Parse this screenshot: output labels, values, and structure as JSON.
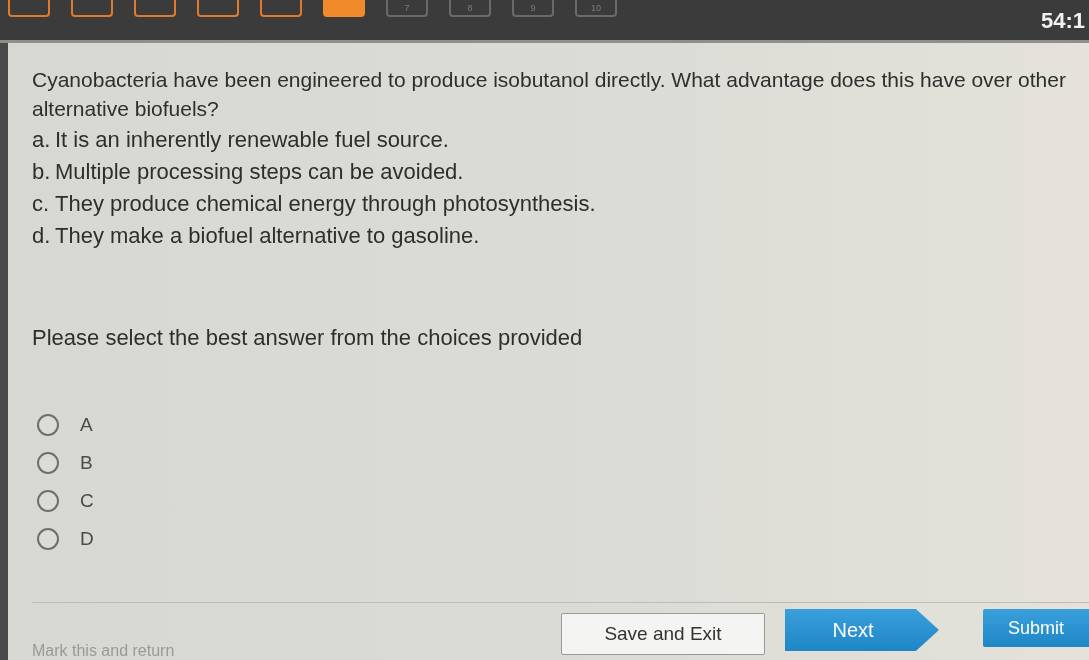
{
  "nav": {
    "questions": [
      {
        "answered": true,
        "selected": false
      },
      {
        "answered": true,
        "selected": false
      },
      {
        "answered": true,
        "selected": false
      },
      {
        "answered": true,
        "selected": false
      },
      {
        "answered": true,
        "selected": false
      },
      {
        "answered": false,
        "selected": true
      },
      {
        "label": "7",
        "answered": false,
        "selected": false
      },
      {
        "label": "8",
        "answered": false,
        "selected": false
      },
      {
        "label": "9",
        "answered": false,
        "selected": false
      },
      {
        "label": "10",
        "answered": false,
        "selected": false
      }
    ],
    "timer": "54:1"
  },
  "question": {
    "prompt": "Cyanobacteria have been engineered to produce isobutanol directly. What advantage does this have over other alternative biofuels?",
    "options": [
      {
        "letter": "a.",
        "text": "It is an inherently renewable fuel source."
      },
      {
        "letter": "b.",
        "text": "Multiple processing steps can be avoided."
      },
      {
        "letter": "c.",
        "text": "They produce chemical energy through photosynthesis."
      },
      {
        "letter": "d.",
        "text": "They make a biofuel alternative to gasoline."
      }
    ]
  },
  "instruction": "Please select the best answer from the choices provided",
  "answers": [
    {
      "label": "A",
      "selected": false
    },
    {
      "label": "B",
      "selected": false
    },
    {
      "label": "C",
      "selected": false
    },
    {
      "label": "D",
      "selected": false
    }
  ],
  "footer": {
    "mark_link": "Mark this and return",
    "buttons": [
      {
        "label": "Save and Exit",
        "kind": "secondary"
      },
      {
        "label": "Next",
        "kind": "next"
      },
      {
        "label": "Submit",
        "kind": "primary"
      }
    ]
  }
}
